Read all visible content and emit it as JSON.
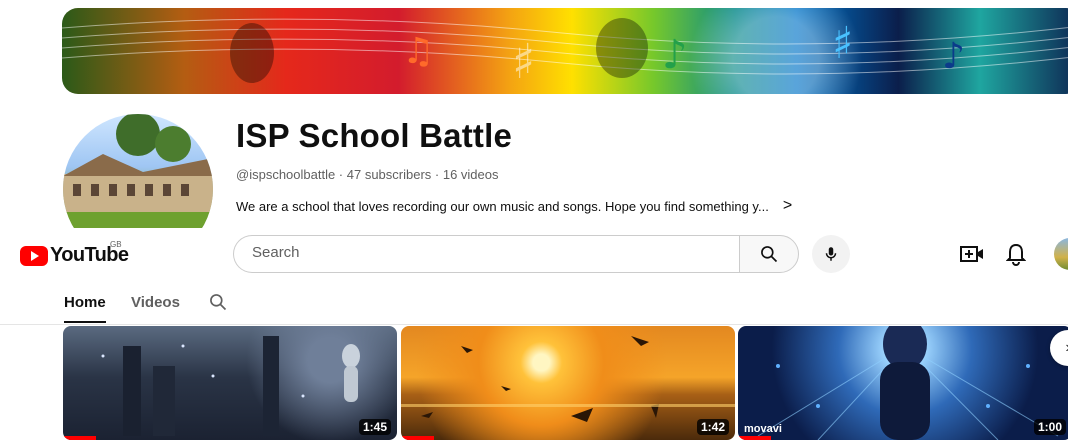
{
  "channel": {
    "title": "ISP School Battle",
    "meta": "@ispschoolbattle · 47 subscribers · 16 videos",
    "description": "We are a school that loves recording our own music and songs. Hope you find something y...",
    "description_more": ">"
  },
  "masthead": {
    "logo_text": "YouTube",
    "country_code": "GB",
    "search_placeholder": "Search",
    "icons": [
      "search-icon",
      "microphone-icon",
      "create-video-icon",
      "notifications-bell-icon",
      "user-avatar"
    ]
  },
  "tabs": [
    {
      "label": "Home",
      "active": true
    },
    {
      "label": "Videos",
      "active": false
    }
  ],
  "videos": [
    {
      "duration": "1:45",
      "progress_percent": 10
    },
    {
      "duration": "1:42",
      "progress_percent": 10
    },
    {
      "duration": "1:00",
      "progress_percent": 10,
      "watermark": "movavi"
    }
  ],
  "colors": {
    "brand_red": "#ff0000",
    "text_primary": "#0f0f0f",
    "text_secondary": "#606060"
  }
}
